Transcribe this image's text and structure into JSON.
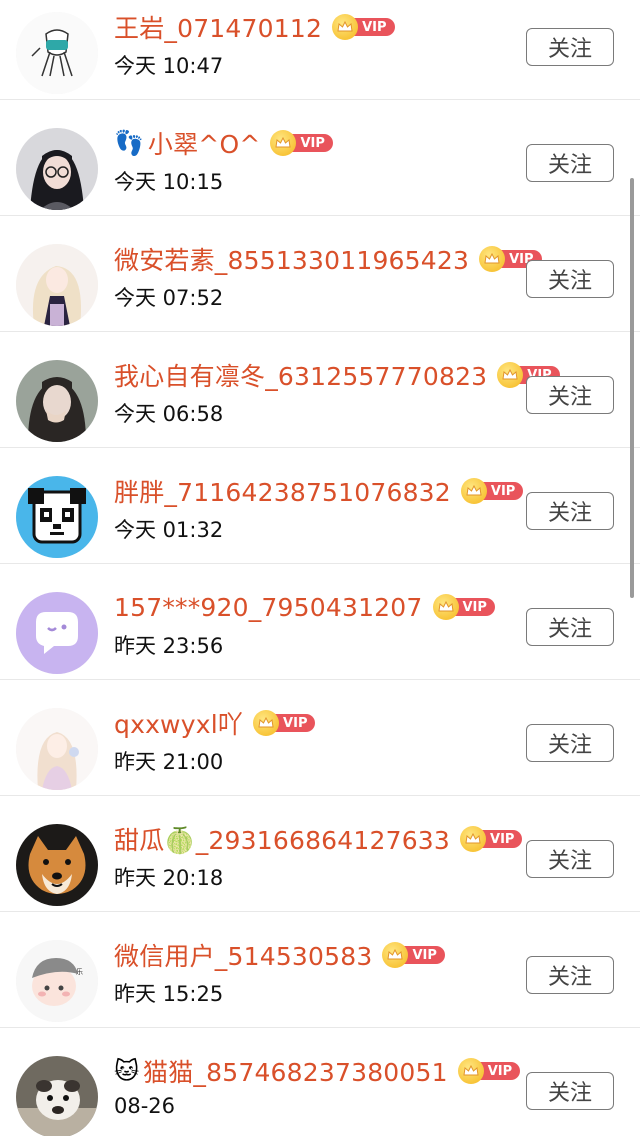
{
  "follow_label": "关注",
  "vip_label": "VIP",
  "rows": [
    {
      "prefix": "",
      "name": "王岩_071470112",
      "time": "今天 10:47",
      "avatar": "mask-figure"
    },
    {
      "prefix": "👣",
      "name": "小翠^O^",
      "time": "今天 10:15",
      "avatar": "girl-glasses"
    },
    {
      "prefix": "",
      "name": "微安若素_855133011965423",
      "time": "今天 07:52",
      "avatar": "anime-girl"
    },
    {
      "prefix": "",
      "name": "我心自有凛冬_6312557770823",
      "time": "今天 06:58",
      "avatar": "girl-photo"
    },
    {
      "prefix": "",
      "name": "胖胖_71164238751076832",
      "time": "今天 01:32",
      "avatar": "panda"
    },
    {
      "prefix": "",
      "name": "157***920_7950431207",
      "time": "昨天 23:56",
      "avatar": "chat-bubble"
    },
    {
      "prefix": "",
      "name": "qxxwyxl吖",
      "time": "昨天 21:00",
      "avatar": "anime-girl-2"
    },
    {
      "prefix": "",
      "name": "甜瓜🍈_293166864127633",
      "time": "昨天 20:18",
      "avatar": "shiba-dog"
    },
    {
      "prefix": "",
      "name": "微信用户_514530583",
      "time": "昨天 15:25",
      "avatar": "cartoon-baby"
    },
    {
      "prefix": "🐱",
      "name": "猫猫_857468237380051",
      "time": "08-26",
      "avatar": "pug-dog"
    }
  ]
}
